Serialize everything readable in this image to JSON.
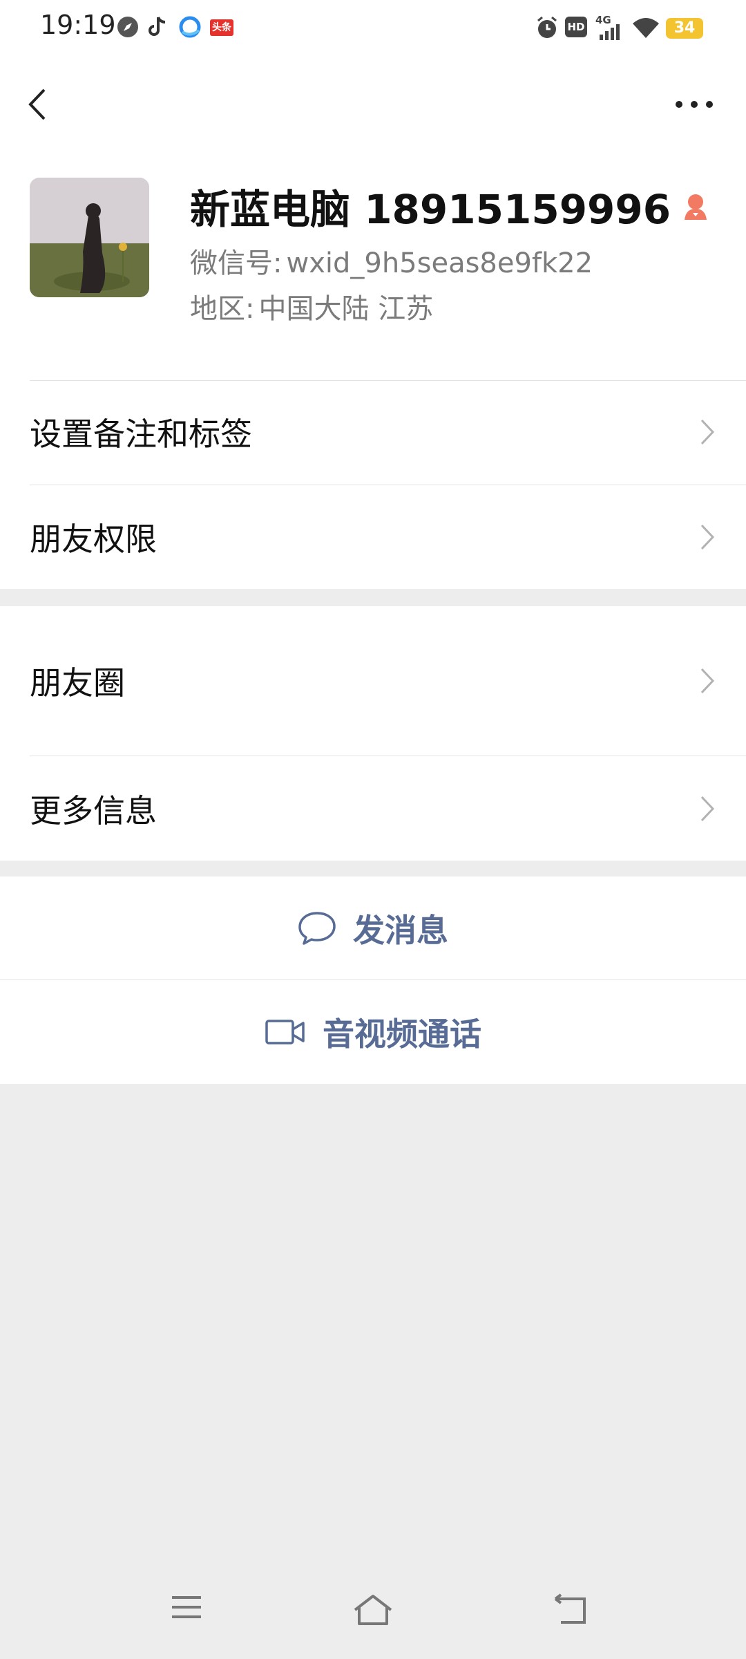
{
  "status_bar": {
    "time": "19:19",
    "left_icons": [
      "compass-icon",
      "tiktok-icon",
      "browser-icon",
      "toutiao-icon"
    ],
    "toutiao_label": "头条",
    "right_icons": [
      "alarm-icon",
      "hd-icon",
      "signal-4g-icon",
      "wifi-icon",
      "battery-icon"
    ],
    "network": "4G",
    "hd": "HD",
    "battery": "34",
    "battery_color": "#f4c430"
  },
  "nav": {
    "back_icon": "chevron-left-icon",
    "more_icon": "more-horizontal-icon"
  },
  "profile": {
    "name": "新蓝电脑  18915159996",
    "gender_icon": "female-icon",
    "gender_color": "#f37a62",
    "wxid_label": "微信号:",
    "wxid_value": "wxid_9h5seas8e9fk22",
    "region_label": "地区:",
    "region_value": "中国大陆  江苏"
  },
  "menu": {
    "remark": "设置备注和标签",
    "permissions": "朋友权限",
    "moments": "朋友圈",
    "more_info": "更多信息"
  },
  "actions": {
    "message": "发消息",
    "call": "音视频通话",
    "accent_color": "#576b95"
  },
  "system_nav": {
    "icons": [
      "menu-icon",
      "home-icon",
      "back-icon"
    ]
  }
}
